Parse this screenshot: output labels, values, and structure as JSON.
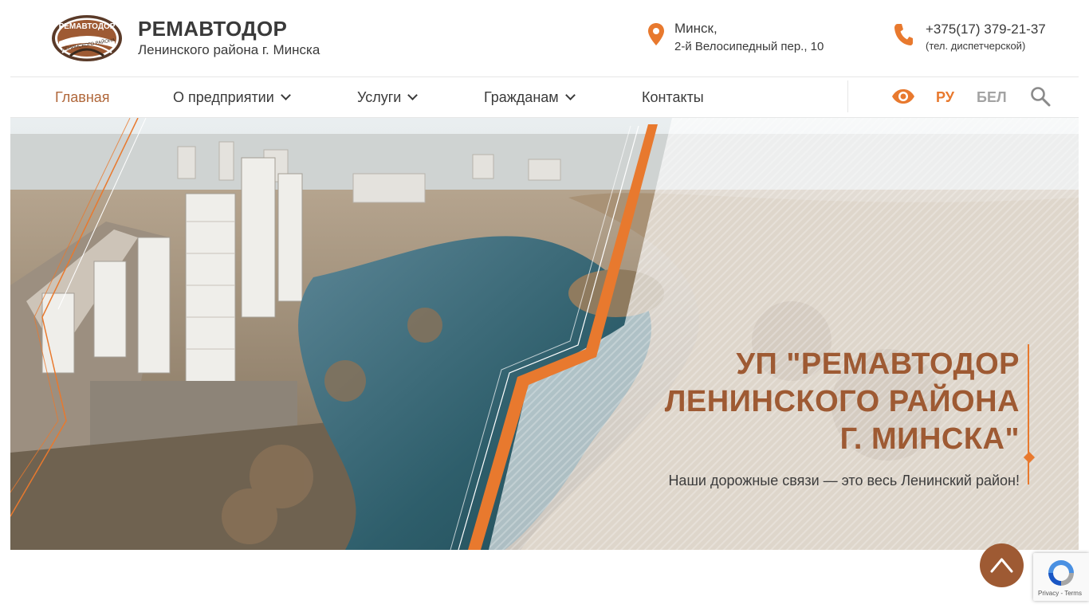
{
  "header": {
    "logo": {
      "text_top": "РЕМАВТОДОР",
      "text_bottom": "ЛЕНИНСКОГО РАЙОНА",
      "icon": "company-logo"
    },
    "brand_title": "РЕМАВТОДОР",
    "brand_subtitle": "Ленинского района г. Минска",
    "address": {
      "icon": "map-pin-icon",
      "city": "Минск,",
      "street": "2-й Велосипедный пер., 10"
    },
    "phone": {
      "icon": "phone-icon",
      "number": "+375(17) 379-21-37",
      "note": "(тел. диспетчерской)"
    }
  },
  "nav": {
    "items": [
      {
        "label": "Главная",
        "active": true,
        "dropdown": false
      },
      {
        "label": "О предприятии",
        "active": false,
        "dropdown": true
      },
      {
        "label": "Услуги",
        "active": false,
        "dropdown": true
      },
      {
        "label": "Гражданам",
        "active": false,
        "dropdown": true
      },
      {
        "label": "Контакты",
        "active": false,
        "dropdown": false
      }
    ],
    "accessibility_icon": "eye-icon",
    "languages": [
      {
        "label": "РУ",
        "active": true
      },
      {
        "label": "БЕЛ",
        "active": false
      }
    ],
    "search_icon": "search-icon"
  },
  "hero": {
    "title_line1": "УП \"РЕМАВТОДОР",
    "title_line2": "ЛЕНИНСКОГО РАЙОНА",
    "title_line3": "Г. МИНСКА\"",
    "subtitle": "Наши дорожные связи — это весь Ленинский район!"
  },
  "scroll_top": {
    "icon": "arrow-up-icon"
  },
  "recaptcha": {
    "links": "Privacy - Terms"
  },
  "colors": {
    "accent": "#e8792e",
    "brand_brown": "#9e5a33",
    "text": "#3a3a3a",
    "inactive_lang": "#a3a3a3"
  }
}
